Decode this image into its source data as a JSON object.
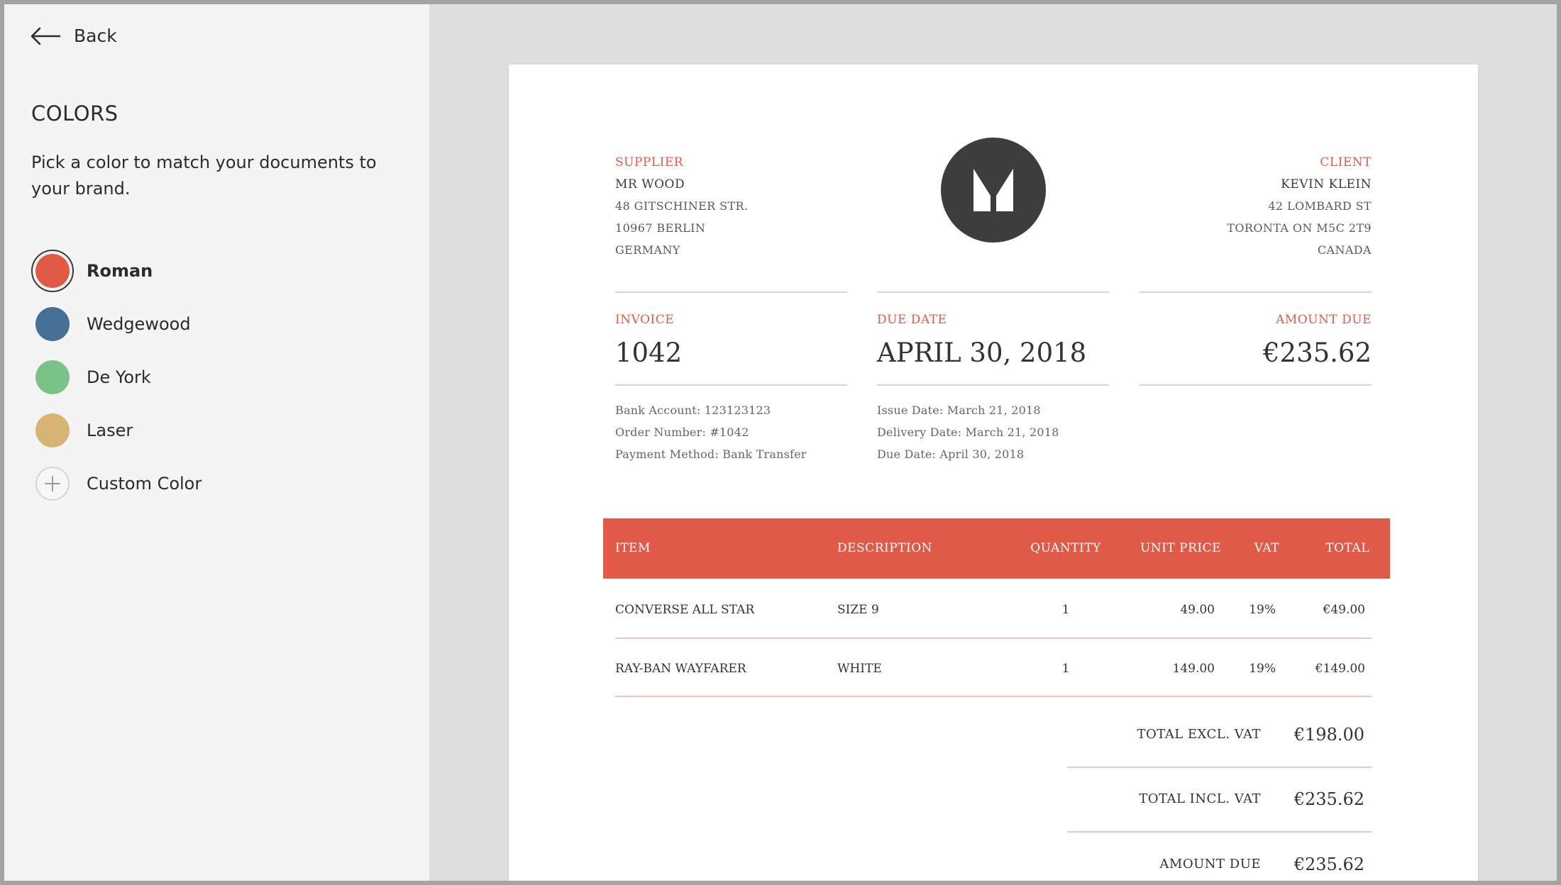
{
  "sidebar": {
    "back_label": "Back",
    "title": "COLORS",
    "description": "Pick a color to match your documents to your brand.",
    "colors": [
      {
        "label": "Roman",
        "hex": "#e05a47",
        "selected": true
      },
      {
        "label": "Wedgewood",
        "hex": "#447095",
        "selected": false
      },
      {
        "label": "De York",
        "hex": "#7bc18a",
        "selected": false
      },
      {
        "label": "Laser",
        "hex": "#d5b474",
        "selected": false
      },
      {
        "label": "Custom Color",
        "hex": "",
        "selected": false,
        "icon": "plus-icon"
      }
    ]
  },
  "invoice": {
    "accent": "#e05a47",
    "supplier": {
      "heading": "SUPPLIER",
      "name": "MR WOOD",
      "lines": [
        "48 GITSCHINER STR.",
        "10967 BERLIN",
        "GERMANY"
      ]
    },
    "client": {
      "heading": "CLIENT",
      "name": "KEVIN KLEIN",
      "lines": [
        "42 LOMBARD ST",
        "TORONTA ON M5C 2T9",
        "CANADA"
      ]
    },
    "logo_icon": "m-logo-icon",
    "summary": {
      "invoice_label": "INVOICE",
      "invoice_value": "1042",
      "due_label": "DUE DATE",
      "due_value": "APRIL 30, 2018",
      "amount_label": "AMOUNT DUE",
      "amount_value": "€235.62"
    },
    "details_left": [
      "Bank Account: 123123123",
      "Order Number: #1042",
      "Payment Method: Bank Transfer"
    ],
    "details_mid": [
      "Issue Date: March 21, 2018",
      "Delivery Date: March 21, 2018",
      "Due Date: April 30, 2018"
    ],
    "table": {
      "headers": {
        "item": "ITEM",
        "description": "DESCRIPTION",
        "quantity": "QUANTITY",
        "unit_price": "UNIT PRICE",
        "vat": "VAT",
        "total": "TOTAL"
      },
      "rows": [
        {
          "item": "CONVERSE ALL STAR",
          "description": "SIZE 9",
          "quantity": "1",
          "unit_price": "49.00",
          "vat": "19%",
          "total": "€49.00"
        },
        {
          "item": "RAY-BAN WAYFARER",
          "description": "WHITE",
          "quantity": "1",
          "unit_price": "149.00",
          "vat": "19%",
          "total": "€149.00"
        }
      ]
    },
    "totals": {
      "excl_label": "TOTAL EXCL. VAT",
      "excl_value": "€198.00",
      "incl_label": "TOTAL INCL. VAT",
      "incl_value": "€235.62",
      "due_label": "AMOUNT DUE",
      "due_value": "€235.62"
    }
  }
}
